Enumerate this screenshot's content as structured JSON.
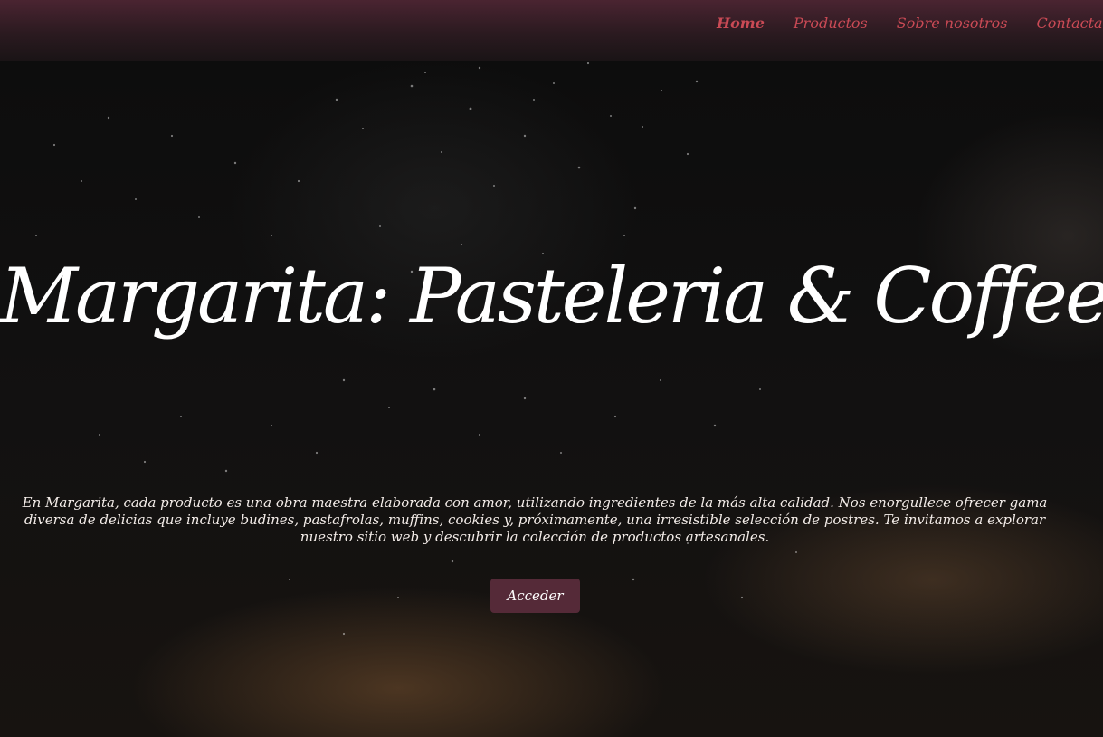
{
  "navbar": {
    "links": [
      {
        "label": "Home",
        "active": true
      },
      {
        "label": "Productos",
        "active": false
      },
      {
        "label": "Sobre nosotros",
        "active": false
      },
      {
        "label": "Contactanos",
        "active": false
      }
    ]
  },
  "hero": {
    "title": "Margarita: Pasteleria & Coffee",
    "description": "En Margarita, cada producto es una obra maestra elaborada con amor, utilizando ingredientes de la más alta calidad. Nos enorgullece ofrecer gama diversa de delicias que incluye budines, pastafrolas, muffins, cookies y, próximamente, una irresistible selección de postres. Te invitamos a explorar nuestro sitio web y descubrir la colección de productos artesanales.",
    "button_label": "Acceder"
  },
  "colors": {
    "navbar": "#3a1f28",
    "nav_link": "#c94a55",
    "button": "#552a38",
    "title": "#ffffff",
    "text": "#f3ece8"
  }
}
